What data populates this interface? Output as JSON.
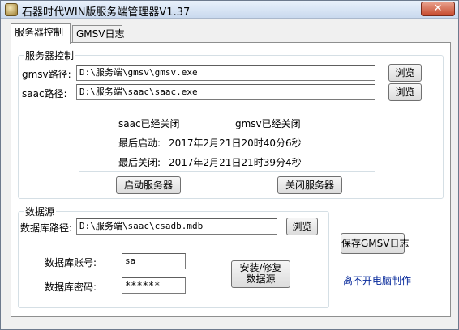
{
  "window": {
    "title": "石器时代WIN版服务端管理器V1.37",
    "close_glyph": "✕"
  },
  "tabs": [
    {
      "label": "服务器控制",
      "active": true
    },
    {
      "label": "GMSV日志",
      "active": false
    }
  ],
  "server_control": {
    "group_title": "服务器控制",
    "gmsv_label": "gmsv路径:",
    "gmsv_path": "D:\\服务端\\gmsv\\gmsv.exe",
    "saac_label": "saac路径:",
    "saac_path": "D:\\服务端\\saac\\saac.exe",
    "browse_label": "浏览",
    "saac_status": "saac已经关闭",
    "gmsv_status": "gmsv已经关闭",
    "last_start_label": "最后启动:",
    "last_start_value": "2017年2月21日20时40分6秒",
    "last_stop_label": "最后关闭:",
    "last_stop_value": "2017年2月21日21时39分4秒",
    "start_button": "启动服务器",
    "stop_button": "关闭服务器"
  },
  "data_source": {
    "group_title": "数据源",
    "db_path_label": "数据库路径:",
    "db_path": "D:\\服务端\\saac\\csadb.mdb",
    "browse_label": "浏览",
    "account_label": "数据库账号:",
    "account_value": "sa",
    "password_label": "数据库密码:",
    "password_value": "******",
    "install_button_line1": "安装/修复",
    "install_button_line2": "数据源"
  },
  "save_log_button": "保存GMSV日志",
  "credit": "离不开电脑制作"
}
